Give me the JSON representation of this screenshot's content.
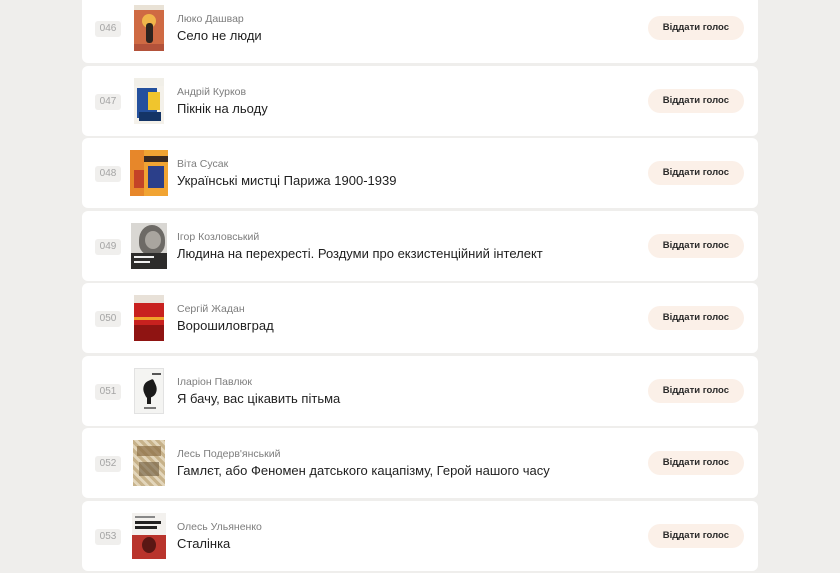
{
  "books": [
    {
      "number": "046",
      "author": "Люко Дашвар",
      "title": "Село не люди",
      "vote_label": "Віддати голос",
      "cover": "cover-sun-figure"
    },
    {
      "number": "047",
      "author": "Андрій Курков",
      "title": "Пікнік на льоду",
      "vote_label": "Віддати голос",
      "cover": "cover-blue-yellow"
    },
    {
      "number": "048",
      "author": "Віта Сусак",
      "title": "Українські мистці Парижа 1900-1939",
      "vote_label": "Віддати голос",
      "cover": "cover-orange-geometric"
    },
    {
      "number": "049",
      "author": "Ігор Козловський",
      "title": "Людина на перехресті. Роздуми про екзистенційний інтелект",
      "vote_label": "Віддати голос",
      "cover": "cover-portrait-bw"
    },
    {
      "number": "050",
      "author": "Сергій Жадан",
      "title": "Ворошиловград",
      "vote_label": "Віддати голос",
      "cover": "cover-red-landscape"
    },
    {
      "number": "051",
      "author": "Іларіон Павлюк",
      "title": "Я бачу, вас цікавить пітьма",
      "vote_label": "Віддати голос",
      "cover": "cover-white-raven"
    },
    {
      "number": "052",
      "author": "Лесь Подерв'янський",
      "title": "Гамлєт, або Феномен датського кацапізму, Герой нашого часу",
      "vote_label": "Віддати голос",
      "cover": "cover-ornament-beige"
    },
    {
      "number": "053",
      "author": "Олесь Ульяненко",
      "title": "Сталінка",
      "vote_label": "Віддати голос",
      "cover": "cover-white-red"
    }
  ]
}
